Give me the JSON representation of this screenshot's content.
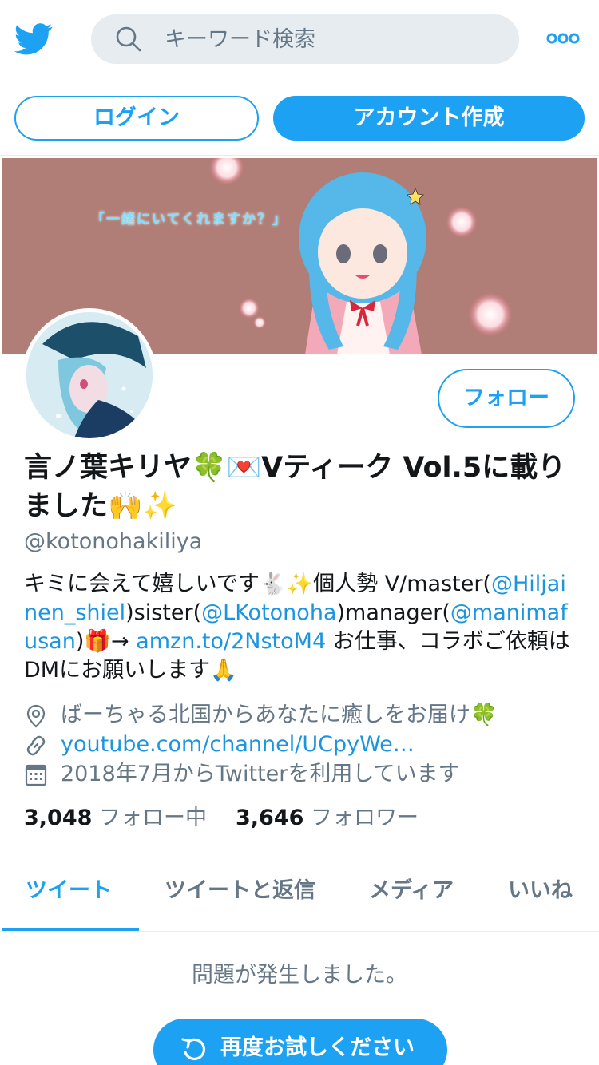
{
  "header": {
    "logo_icon": "twitter-bird-icon",
    "search_placeholder": "キーワード検索",
    "more_icon": "more-dots-icon"
  },
  "auth": {
    "login_label": "ログイン",
    "signup_label": "アカウント作成"
  },
  "banner": {
    "caption": "「一緒にいてくれますか？」"
  },
  "profile": {
    "follow_label": "フォロー",
    "name": "言ノ葉キリヤ🍀💌Vティーク Vol.5に載りました🙌✨",
    "handle": "@kotonohakiliya",
    "bio": {
      "t1": "キミに会えて嬉しいです🐇✨個人勢 V/master(",
      "link1": "@Hiljainen_shiel",
      "t2": ")sister(",
      "link2": "@LKotonoha",
      "t3": ")manager(",
      "link3": "@manimafusan",
      "t4": ")🎁→ ",
      "link4": "amzn.to/2NstoM4",
      "t5": " お仕事、コラボご依頼はDMにお願いします🙏"
    },
    "location": "ばーちゃる北国からあなたに癒しをお届け🍀",
    "url": "youtube.com/channel/UCpyWe…",
    "joined": "2018年7月からTwitterを利用しています",
    "following_count": "3,048",
    "following_label": "フォロー中",
    "followers_count": "3,646",
    "followers_label": "フォロワー"
  },
  "tabs": [
    {
      "label": "ツイート",
      "active": true
    },
    {
      "label": "ツイートと返信",
      "active": false
    },
    {
      "label": "メディア",
      "active": false
    },
    {
      "label": "いいね",
      "active": false
    }
  ],
  "error": {
    "message": "問題が発生しました。",
    "retry_label": "再度お試しください"
  },
  "colors": {
    "accent": "#1da1f2",
    "link": "#1b95e0",
    "secondary_text": "#657786",
    "banner_bg": "#b07e76"
  }
}
